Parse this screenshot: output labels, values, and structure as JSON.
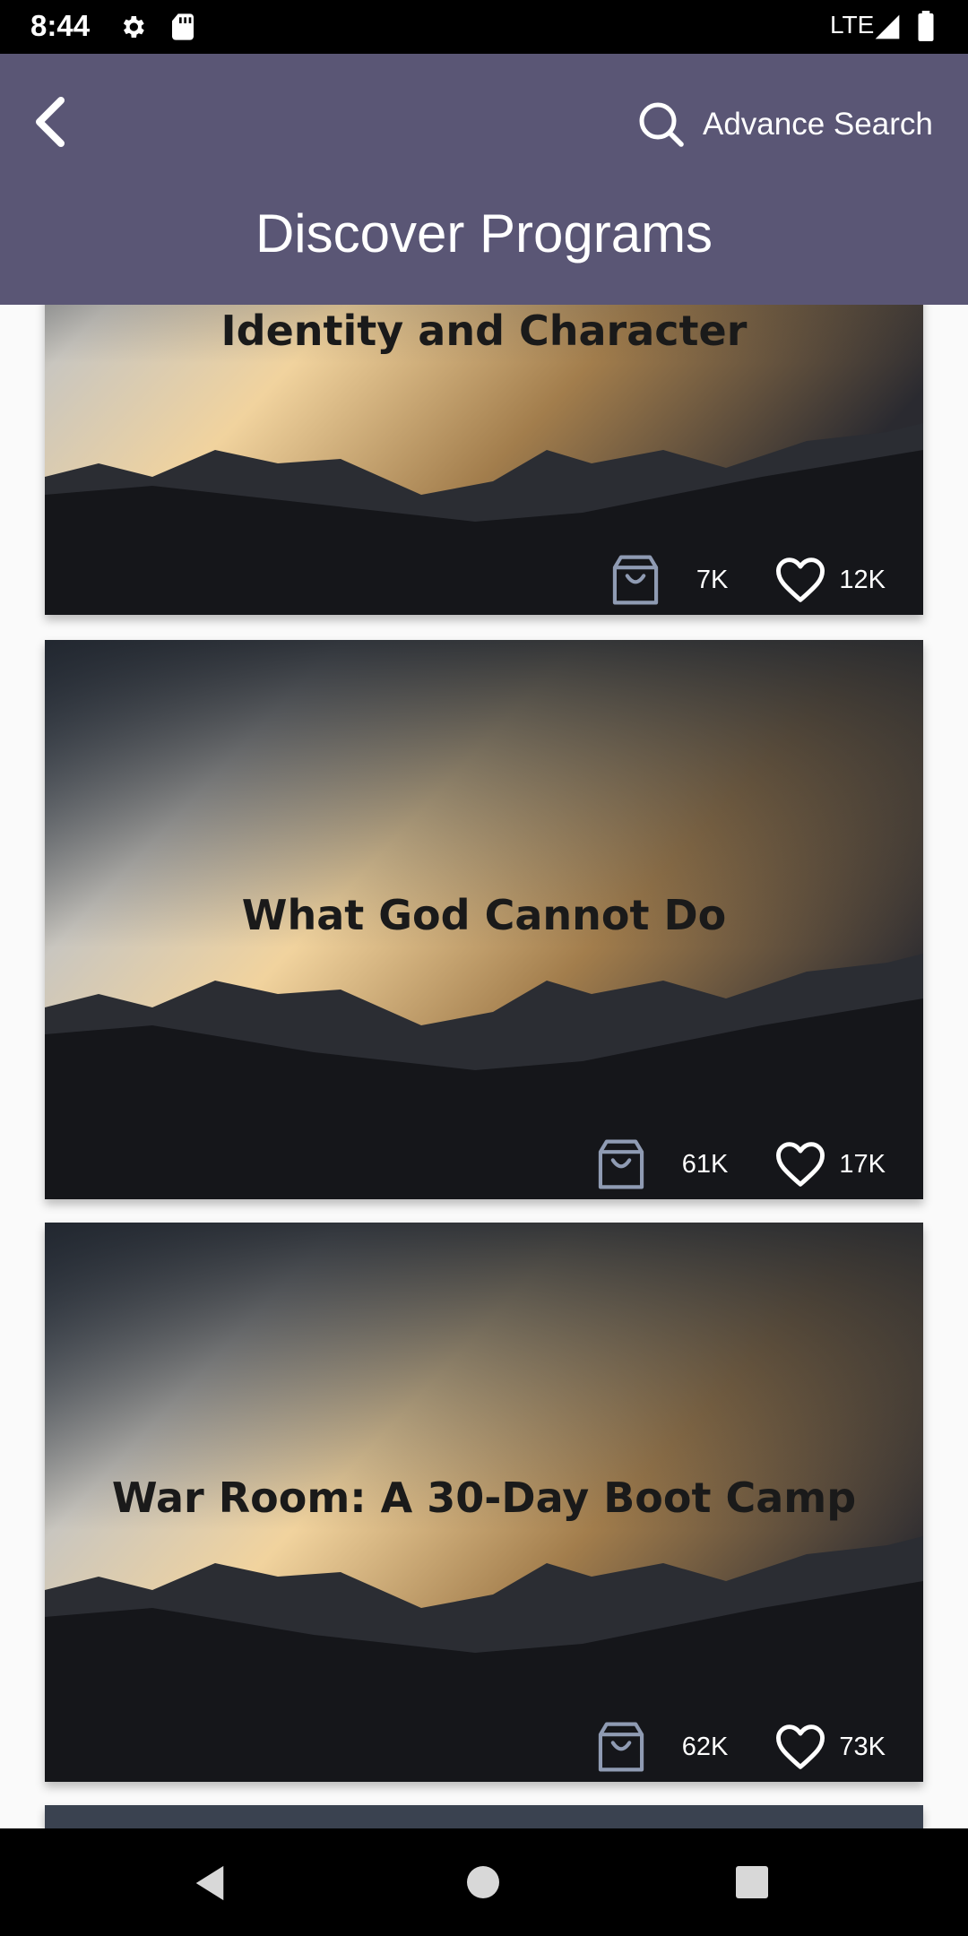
{
  "status_bar": {
    "time": "8:44",
    "network": "LTE"
  },
  "header": {
    "advance_search_label": "Advance Search",
    "title": "Discover Programs"
  },
  "programs": [
    {
      "title": "Identity and Character",
      "purchases": "7K",
      "likes": "12K"
    },
    {
      "title": "What God Cannot Do",
      "purchases": "61K",
      "likes": "17K"
    },
    {
      "title": "War Room: A 30-Day Boot Camp",
      "purchases": "62K",
      "likes": "73K"
    }
  ],
  "colors": {
    "header_bg": "#5a5675",
    "icon_bag": "#8f9bb3"
  }
}
